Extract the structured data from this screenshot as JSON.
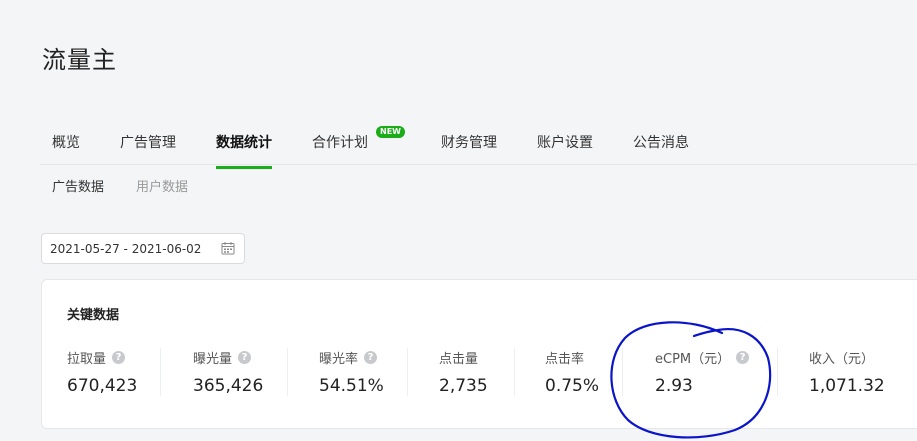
{
  "header": {
    "title": "流量主"
  },
  "tabs": [
    {
      "label": "概览",
      "active": false
    },
    {
      "label": "广告管理",
      "active": false
    },
    {
      "label": "数据统计",
      "active": true
    },
    {
      "label": "合作计划",
      "active": false,
      "badge": "NEW"
    },
    {
      "label": "财务管理",
      "active": false
    },
    {
      "label": "账户设置",
      "active": false
    },
    {
      "label": "公告消息",
      "active": false
    }
  ],
  "subtabs": [
    {
      "label": "广告数据",
      "active": true
    },
    {
      "label": "用户数据",
      "active": false
    }
  ],
  "date_range": {
    "value": "2021-05-27 - 2021-06-02",
    "icon": "calendar-icon"
  },
  "key_data": {
    "title": "关键数据",
    "metrics": [
      {
        "label": "拉取量",
        "value": "670,423",
        "help": true
      },
      {
        "label": "曝光量",
        "value": "365,426",
        "help": true
      },
      {
        "label": "曝光率",
        "value": "54.51%",
        "help": true
      },
      {
        "label": "点击量",
        "value": "2,735",
        "help": false
      },
      {
        "label": "点击率",
        "value": "0.75%",
        "help": false
      },
      {
        "label": "eCPM（元）",
        "value": "2.93",
        "help": true
      },
      {
        "label": "收入（元）",
        "value": "1,071.32",
        "help": false
      }
    ]
  },
  "colors": {
    "accent": "#1aad19",
    "annotation": "#0a14c8"
  }
}
